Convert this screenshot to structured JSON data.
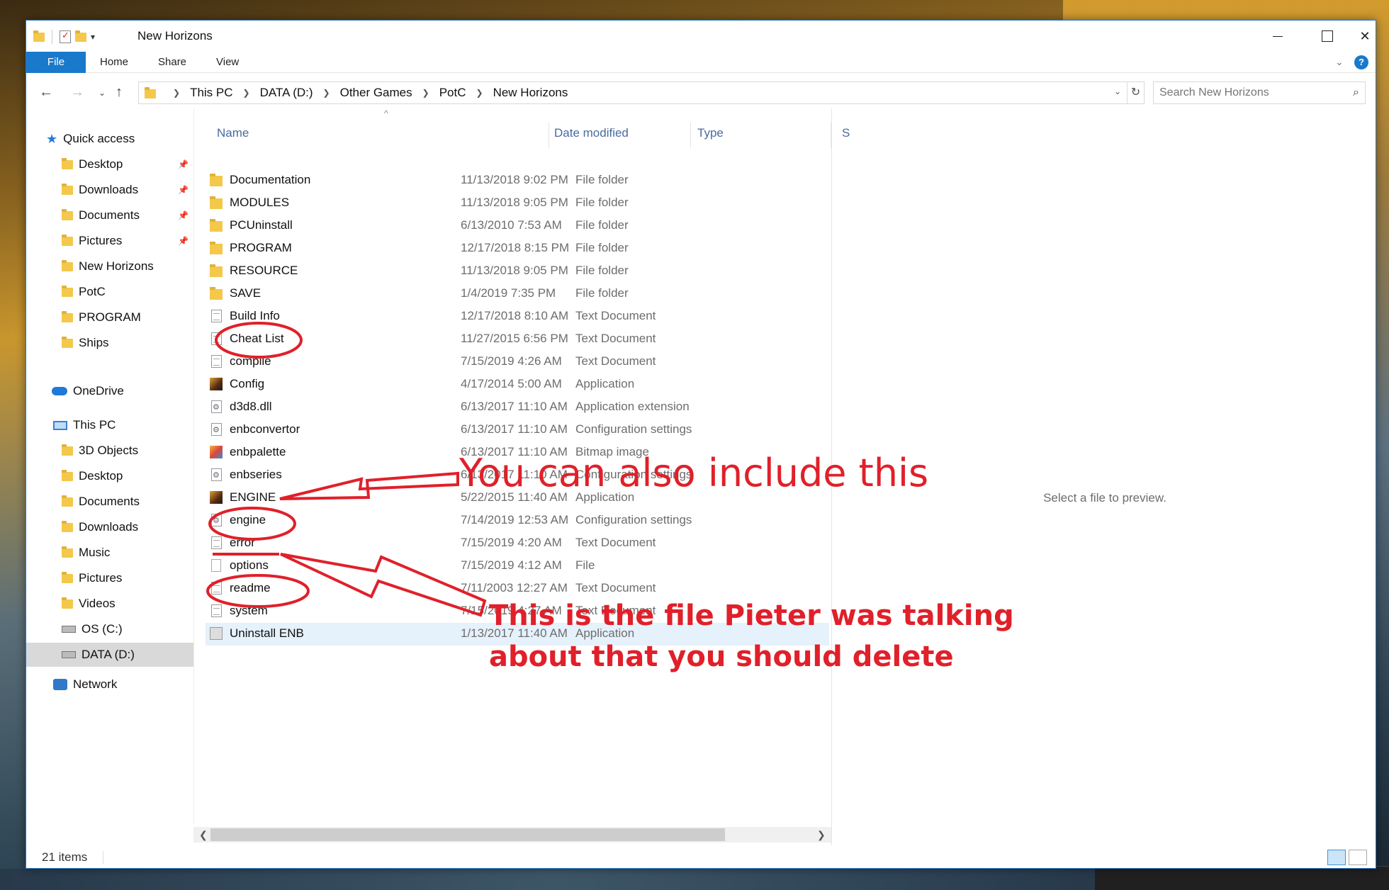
{
  "window": {
    "title": "New Horizons"
  },
  "ribbon": {
    "tabs": [
      "File",
      "Home",
      "Share",
      "View"
    ]
  },
  "address": {
    "crumbs": [
      "This PC",
      "DATA (D:)",
      "Other Games",
      "PotC",
      "New Horizons"
    ],
    "search_placeholder": "Search New Horizons"
  },
  "nav": {
    "quick_access": "Quick access",
    "quick_items": [
      {
        "label": "Desktop",
        "pinned": true
      },
      {
        "label": "Downloads",
        "pinned": true
      },
      {
        "label": "Documents",
        "pinned": true
      },
      {
        "label": "Pictures",
        "pinned": true
      },
      {
        "label": "New Horizons"
      },
      {
        "label": "PotC"
      },
      {
        "label": "PROGRAM"
      },
      {
        "label": "Ships"
      }
    ],
    "onedrive": "OneDrive",
    "this_pc": "This PC",
    "pc_items": [
      "3D Objects",
      "Desktop",
      "Documents",
      "Downloads",
      "Music",
      "Pictures",
      "Videos",
      "OS (C:)",
      "DATA (D:)"
    ],
    "network": "Network"
  },
  "columns": {
    "name": "Name",
    "date": "Date modified",
    "type": "Type",
    "size": "S"
  },
  "files": [
    {
      "name": "Documentation",
      "date": "11/13/2018 9:02 PM",
      "type": "File folder",
      "icon": "folder"
    },
    {
      "name": "MODULES",
      "date": "11/13/2018 9:05 PM",
      "type": "File folder",
      "icon": "folder"
    },
    {
      "name": "PCUninstall",
      "date": "6/13/2010 7:53 AM",
      "type": "File folder",
      "icon": "folder"
    },
    {
      "name": "PROGRAM",
      "date": "12/17/2018 8:15 PM",
      "type": "File folder",
      "icon": "folder"
    },
    {
      "name": "RESOURCE",
      "date": "11/13/2018 9:05 PM",
      "type": "File folder",
      "icon": "folder"
    },
    {
      "name": "SAVE",
      "date": "1/4/2019 7:35 PM",
      "type": "File folder",
      "icon": "folder"
    },
    {
      "name": "Build Info",
      "date": "12/17/2018 8:10 AM",
      "type": "Text Document",
      "icon": "doc"
    },
    {
      "name": "Cheat List",
      "date": "11/27/2015 6:56 PM",
      "type": "Text Document",
      "icon": "doc"
    },
    {
      "name": "compile",
      "date": "7/15/2019 4:26 AM",
      "type": "Text Document",
      "icon": "doc"
    },
    {
      "name": "Config",
      "date": "4/17/2014 5:00 AM",
      "type": "Application",
      "icon": "app"
    },
    {
      "name": "d3d8.dll",
      "date": "6/13/2017 11:10 AM",
      "type": "Application extension",
      "icon": "cfg"
    },
    {
      "name": "enbconvertor",
      "date": "6/13/2017 11:10 AM",
      "type": "Configuration settings",
      "icon": "cfg"
    },
    {
      "name": "enbpalette",
      "date": "6/13/2017 11:10 AM",
      "type": "Bitmap image",
      "icon": "bmp"
    },
    {
      "name": "enbseries",
      "date": "6/13/2017 11:10 AM",
      "type": "Configuration settings",
      "icon": "cfg"
    },
    {
      "name": "ENGINE",
      "date": "5/22/2015 11:40 AM",
      "type": "Application",
      "icon": "app"
    },
    {
      "name": "engine",
      "date": "7/14/2019 12:53 AM",
      "type": "Configuration settings",
      "icon": "cfg"
    },
    {
      "name": "error",
      "date": "7/15/2019 4:20 AM",
      "type": "Text Document",
      "icon": "doc"
    },
    {
      "name": "options",
      "date": "7/15/2019 4:12 AM",
      "type": "File",
      "icon": "blank"
    },
    {
      "name": "readme",
      "date": "7/11/2003 12:27 AM",
      "type": "Text Document",
      "icon": "doc"
    },
    {
      "name": "system",
      "date": "7/15/2019 4:27 AM",
      "type": "Text Document",
      "icon": "doc"
    },
    {
      "name": "Uninstall ENB",
      "date": "1/13/2017 11:40 AM",
      "type": "Application",
      "icon": "uninst",
      "selected": true
    }
  ],
  "preview": {
    "text": "Select a file to preview."
  },
  "status": {
    "count": "21 items"
  },
  "annotations": {
    "note1": "You can also include this",
    "note2_line1": "This is the file Pieter was talking",
    "note2_line2": "about that you should delete",
    "color": "#e0202a"
  }
}
